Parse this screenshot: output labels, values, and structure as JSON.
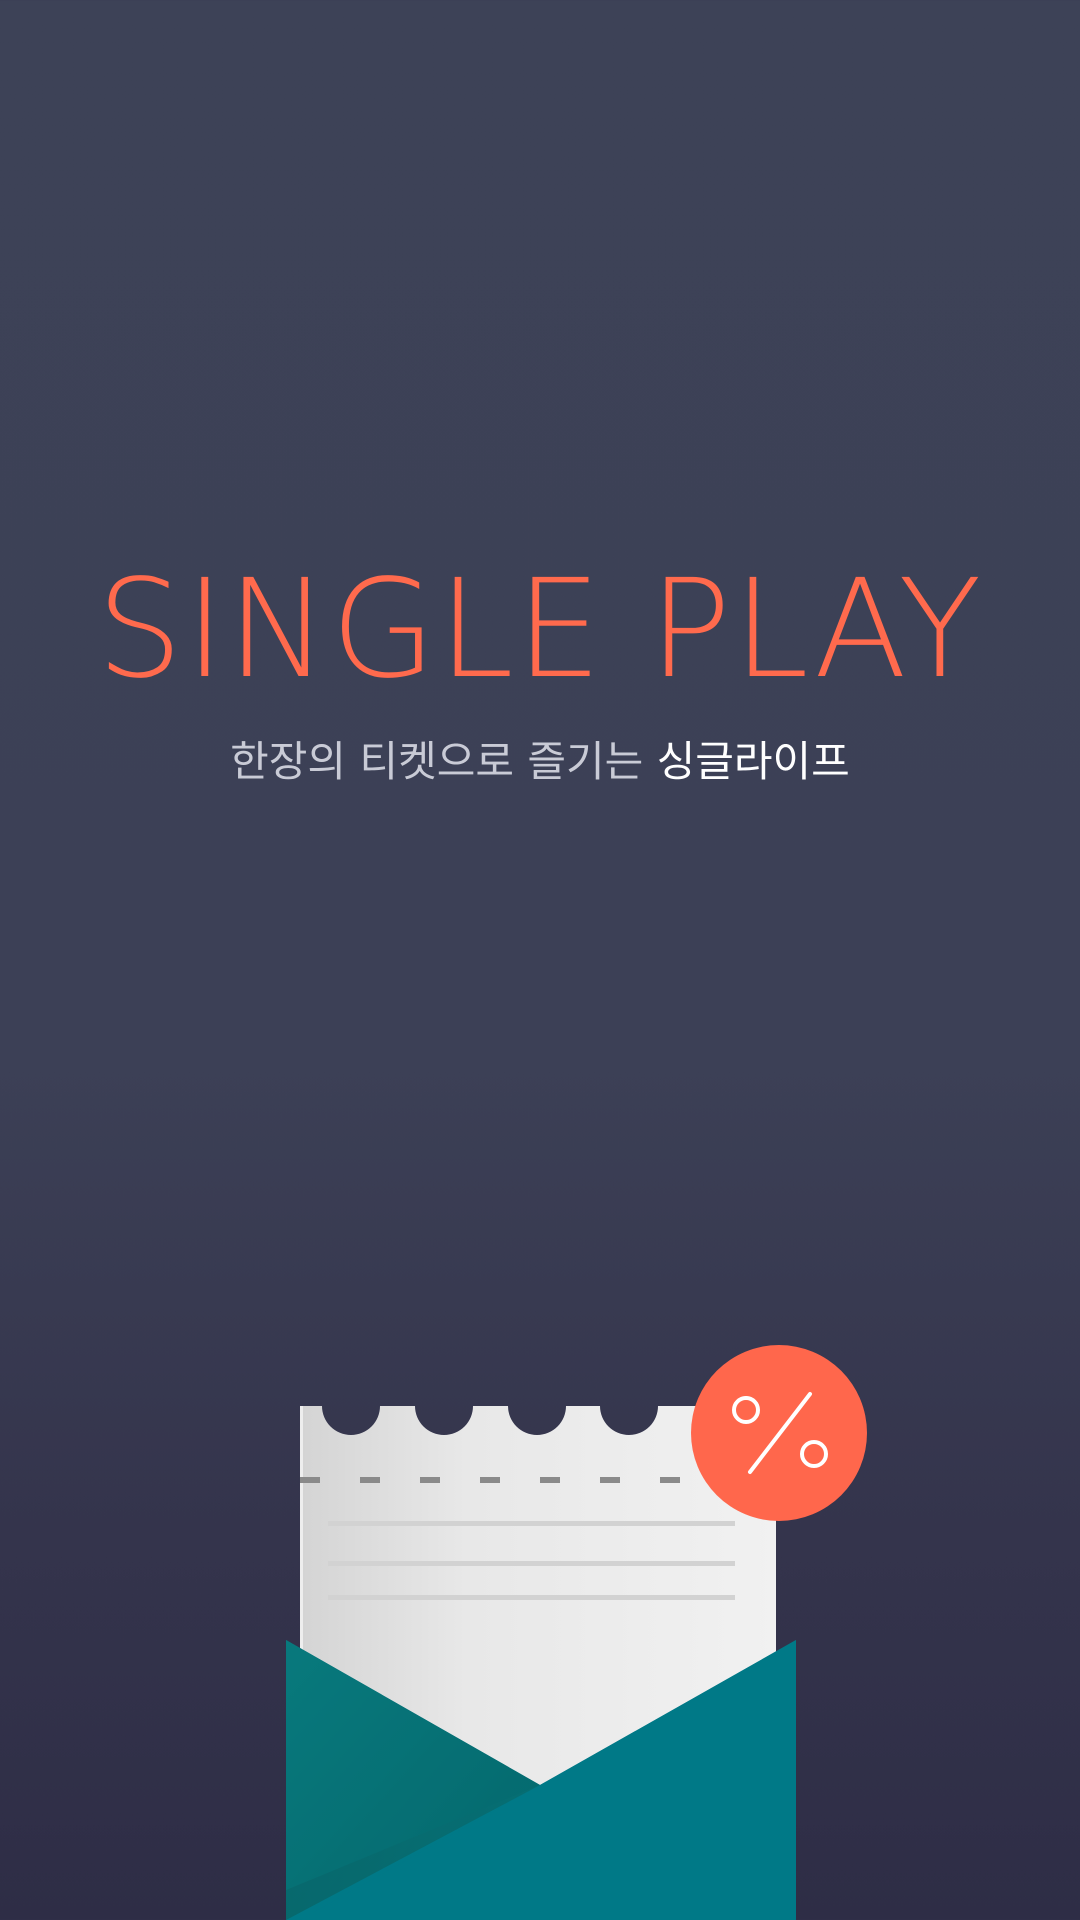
{
  "hero": {
    "title": "SINGLE PLAY",
    "subtitle_prefix": "한장의 티켓으로 즐기는",
    "subtitle_emphasis": "싱글라이프"
  },
  "illustration": {
    "badge_symbol": "%",
    "icon_names": [
      "ticket-icon",
      "envelope-icon",
      "discount-badge-icon"
    ]
  },
  "colors": {
    "background_top": "#3d4257",
    "background_bottom": "#2e2d46",
    "accent": "#ff6a4d",
    "envelope": "#007a87",
    "ticket": "#eeeeee"
  }
}
